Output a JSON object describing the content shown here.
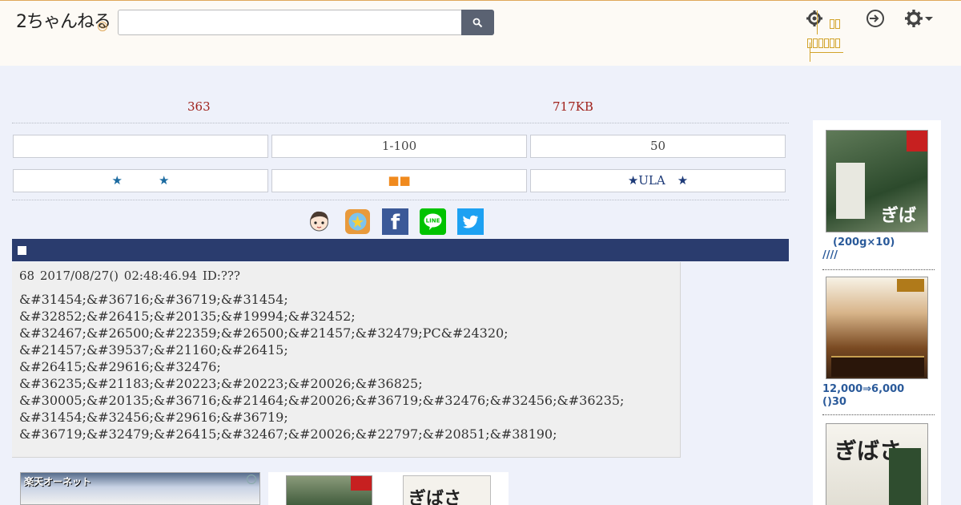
{
  "header": {
    "logo_text": "2ちゃんねる",
    "search_placeholder": "",
    "search_icon": "search-icon",
    "icons": [
      "gear-icon",
      "login-icon",
      "settings-dropdown-icon"
    ]
  },
  "thread_info": {
    "reply_count": "363",
    "size": "717KB"
  },
  "nav_buttons": {
    "row1": [
      "",
      "1-100",
      "50"
    ],
    "row2": [
      "★　　　★",
      "■■",
      "★ULA　★"
    ]
  },
  "share": {
    "icons": [
      "mascot-icon",
      "app-icon",
      "facebook-icon",
      "line-icon",
      "twitter-icon"
    ],
    "facebook_glyph": "f"
  },
  "post": {
    "number": "68",
    "date": "2017/08/27() 02:48:46.94",
    "id": "ID:???",
    "lines": [
      "&#31454;&#36716;&#36719;&#31454;",
      "&#32852;&#26415;&#20135;&#19994;&#32452;",
      "&#32467;&#26500;&#22359;&#26500;&#21457;&#32479;PC&#24320;",
      "&#21457;&#39537;&#21160;&#26415;",
      "&#26415;&#29616;&#32476;",
      "&#36235;&#21183;&#20223;&#20223;&#20026;&#36825;",
      "&#30005;&#20135;&#36716;&#21464;&#20026;&#36719;&#32476;&#32456;&#36235;",
      "&#31454;&#32456;&#29616;&#36719;",
      "&#36719;&#32479;&#26415;&#32467;&#20026;&#22797;&#20851;&#38190;"
    ]
  },
  "ads": {
    "bottom_left_label": "楽天オーネット",
    "bottom_right_product_text": "ぎばさ"
  },
  "sidebar": {
    "items": [
      {
        "image_text": "ぎばさ",
        "text": "　(200g×10)\n////"
      },
      {
        "image_text": "",
        "text": "12,000⇒6,000\n()30"
      },
      {
        "image_text": "ぎばさ",
        "text": ""
      }
    ]
  }
}
